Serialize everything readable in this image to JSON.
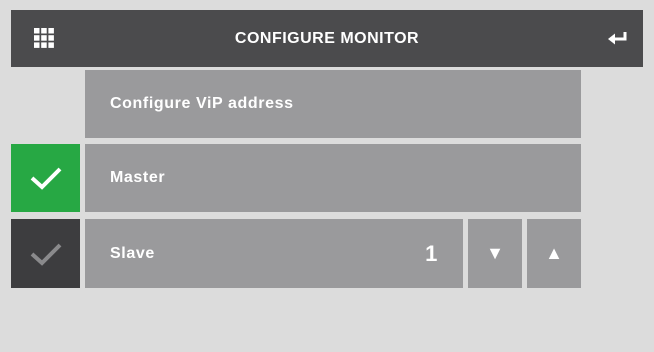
{
  "header": {
    "title": "CONFIGURE MONITOR",
    "menu_icon": "grid-icon",
    "back_icon": "enter-return-icon"
  },
  "rows": {
    "configure_vip": {
      "label": "Configure ViP address"
    },
    "master": {
      "label": "Master",
      "checked": true
    },
    "slave": {
      "label": "Slave",
      "value": "1",
      "checked": false
    }
  },
  "arrows": {
    "down": "▼",
    "up": "▲"
  },
  "colors": {
    "header_bg": "#4b4b4d",
    "row_bg": "#9a9a9c",
    "check_active": "#27a844",
    "check_inactive": "#3d3d3f",
    "page_bg": "#dcdcdc"
  }
}
